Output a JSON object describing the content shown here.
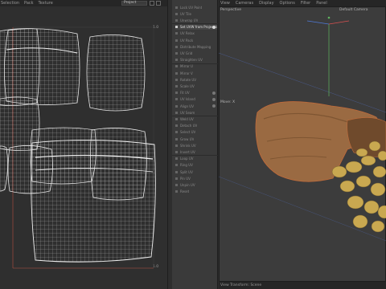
{
  "uv_editor": {
    "menu": [
      "Selection",
      "Pack",
      "Texture"
    ],
    "projection_select": "Project",
    "corner_top_right": "1.0",
    "corner_bottom_right": "1.0"
  },
  "commands": {
    "items": [
      {
        "label": "Lock UV Point",
        "active": false,
        "gear": false
      },
      {
        "label": "UV Tile",
        "active": false,
        "gear": false
      },
      {
        "label": "Unwrap UV",
        "active": false,
        "gear": false
      },
      {
        "label": "Set UVW from Projection",
        "active": true,
        "gear": true
      },
      {
        "label": "UV Relax",
        "active": false,
        "gear": false
      },
      {
        "label": "UV Pack",
        "active": false,
        "gear": false
      },
      {
        "label": "Distribute Mapping",
        "active": false,
        "gear": false
      },
      {
        "label": "UV Grid",
        "active": false,
        "gear": false
      },
      {
        "label": "Straighten UV",
        "active": false,
        "gear": false
      },
      {
        "label": "Mirror U",
        "active": false,
        "gear": false
      },
      {
        "label": "Mirror V",
        "active": false,
        "gear": false
      },
      {
        "label": "Rotate UV",
        "active": false,
        "gear": false
      },
      {
        "label": "Scale UV",
        "active": false,
        "gear": false
      },
      {
        "label": "Fit UV",
        "active": false,
        "gear": true
      },
      {
        "label": "UV Island",
        "active": false,
        "gear": true
      },
      {
        "label": "Align UV",
        "active": false,
        "gear": true
      },
      {
        "label": "UV Seam",
        "active": false,
        "gear": false
      },
      {
        "label": "Weld UV",
        "active": false,
        "gear": false
      },
      {
        "label": "Detach UV",
        "active": false,
        "gear": false
      },
      {
        "label": "Select UV",
        "active": false,
        "gear": false
      },
      {
        "label": "Grow UV",
        "active": false,
        "gear": false
      },
      {
        "label": "Shrink UV",
        "active": false,
        "gear": false
      },
      {
        "label": "Invert UV",
        "active": false,
        "gear": false
      },
      {
        "label": "Loop UV",
        "active": false,
        "gear": false
      },
      {
        "label": "Ring UV",
        "active": false,
        "gear": false
      },
      {
        "label": "Split UV",
        "active": false,
        "gear": false
      },
      {
        "label": "Pin UV",
        "active": false,
        "gear": false
      },
      {
        "label": "Unpin UV",
        "active": false,
        "gear": false
      },
      {
        "label": "Reset",
        "active": false,
        "gear": false
      }
    ]
  },
  "viewport": {
    "menu": [
      "View",
      "Cameras",
      "Display",
      "Options",
      "Filter",
      "Panel"
    ],
    "view_name": "Perspective",
    "camera": "Default Camera",
    "axis_label": "Move: X",
    "status": "View Transform: Scene"
  },
  "colors": {
    "uv_background": "#2f2f2f",
    "uv_wire": "#d8d8d8",
    "viewport_background": "#3c3c3c",
    "sack": "#a06a40",
    "beans": "#c9a850"
  }
}
